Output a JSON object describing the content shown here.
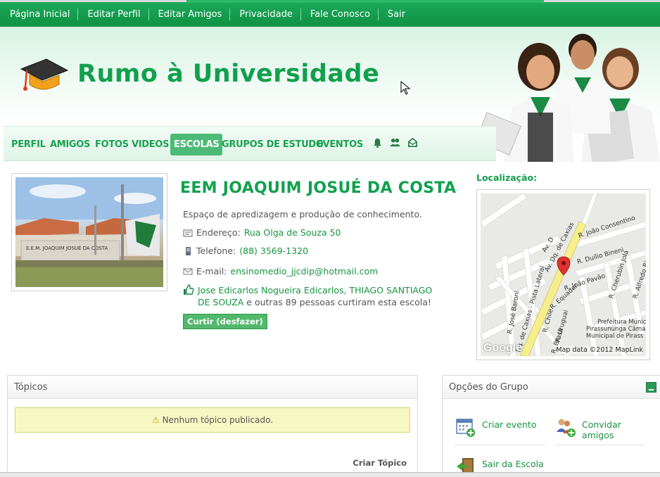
{
  "topnav": [
    "Página Inicial",
    "Editar Perfil",
    "Editar Amigos",
    "Privacidade",
    "Fale Conosco",
    "Sair"
  ],
  "site": {
    "title": "Rumo à Universidade"
  },
  "mainnav": {
    "items": [
      "PERFIL",
      "AMIGOS",
      "FOTOS",
      "VIDEOS",
      "ESCOLAS",
      "GRUPOS DE ESTUDO",
      "EVENTOS"
    ],
    "active": "ESCOLAS"
  },
  "photo": {
    "sign_text": "E.E.M. JOAQUIM JOSUÉ DA COSTA"
  },
  "school": {
    "name": "EEM JOAQUIM JOSUÉ DA COSTA",
    "description": "Espaço de apredizagem e produção de conhecimento.",
    "address_label": "Endereço:",
    "address": "Rua Olga de Souza 50",
    "phone_label": "Telefone:",
    "phone": "(88) 3569-1320",
    "email_label": "E-mail:",
    "email": "ensinomedio_jjcdip@hotmail.com",
    "likes_names": "Jose Edicarlos Nogueira Edicarlos, THIAGO SANTIAGO DE SOUZA",
    "likes_rest": " e outras 89 pessoas curtiram esta escola!",
    "like_button": "Curtir (desfazer)"
  },
  "location": {
    "label": "Localização:",
    "streets": [
      "R. João Consentino",
      "Av. Dq. de Caxias",
      "R. Duílio Bineni",
      "R. João Pavão",
      "R. Cherubin Jola",
      "R. Alfredo Bianc",
      "R. Equador",
      "R. Chile",
      "R. Uruguai",
      "R. Brasil",
      "R. José Baroni",
      "Dq. de Caxias - Pista Lateral",
      "Av. D"
    ],
    "poi": [
      "Prefeitura Municipal",
      "Pirassununga Câmara",
      "Municipal de Pirass"
    ],
    "credit": "Map data ©2012 MapLink",
    "brand": "Google"
  },
  "topics": {
    "title": "Tópicos",
    "empty_notice": "Nenhum tópico publicado.",
    "create": "Criar Tópico"
  },
  "options": {
    "title": "Opções do Grupo",
    "create_event": "Criar evento",
    "invite_friends_line1": "Convidar",
    "invite_friends_line2": "amigos",
    "leave_school": "Sair da Escola"
  },
  "colors": {
    "brand_green": "#11a04d",
    "topbar_green": "#1ca859",
    "notice_bg": "#f6f7c3"
  }
}
